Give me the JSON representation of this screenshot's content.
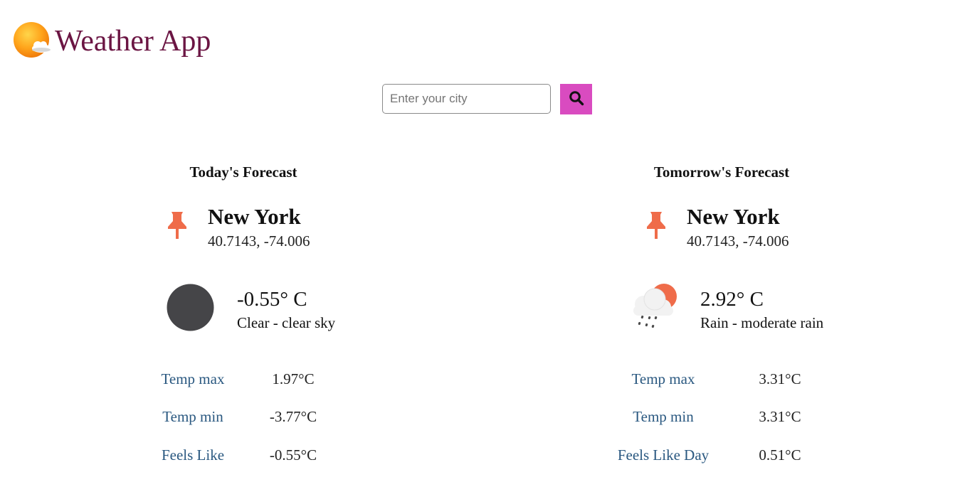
{
  "header": {
    "title": "Weather App",
    "logo_icon": "sun-cloud-icon"
  },
  "search": {
    "placeholder": "Enter your city",
    "value": "",
    "button_icon": "search-icon",
    "button_color": "#d94bc0"
  },
  "today": {
    "title": "Today's Forecast",
    "city": "New York",
    "coords": "40.7143, -74.006",
    "location_icon": "pushpin-icon",
    "weather_icon": "clear-night-icon",
    "temperature": "-0.55° C",
    "description": "Clear - clear sky",
    "stats": [
      {
        "label": "Temp max",
        "value": "1.97°C"
      },
      {
        "label": "Temp min",
        "value": "-3.77°C"
      },
      {
        "label": "Feels Like",
        "value": "-0.55°C"
      }
    ]
  },
  "tomorrow": {
    "title": "Tomorrow's Forecast",
    "city": "New York",
    "coords": "40.7143, -74.006",
    "location_icon": "pushpin-icon",
    "weather_icon": "rain-cloud-sun-icon",
    "temperature": "2.92° C",
    "description": "Rain - moderate rain",
    "stats": [
      {
        "label": "Temp max",
        "value": "3.31°C"
      },
      {
        "label": "Temp min",
        "value": "3.31°C"
      },
      {
        "label": "Feels Like Day",
        "value": "0.51°C"
      }
    ]
  },
  "colors": {
    "title": "#6b1543",
    "stat_label": "#2a5880",
    "pin": "#ef6c4a"
  }
}
